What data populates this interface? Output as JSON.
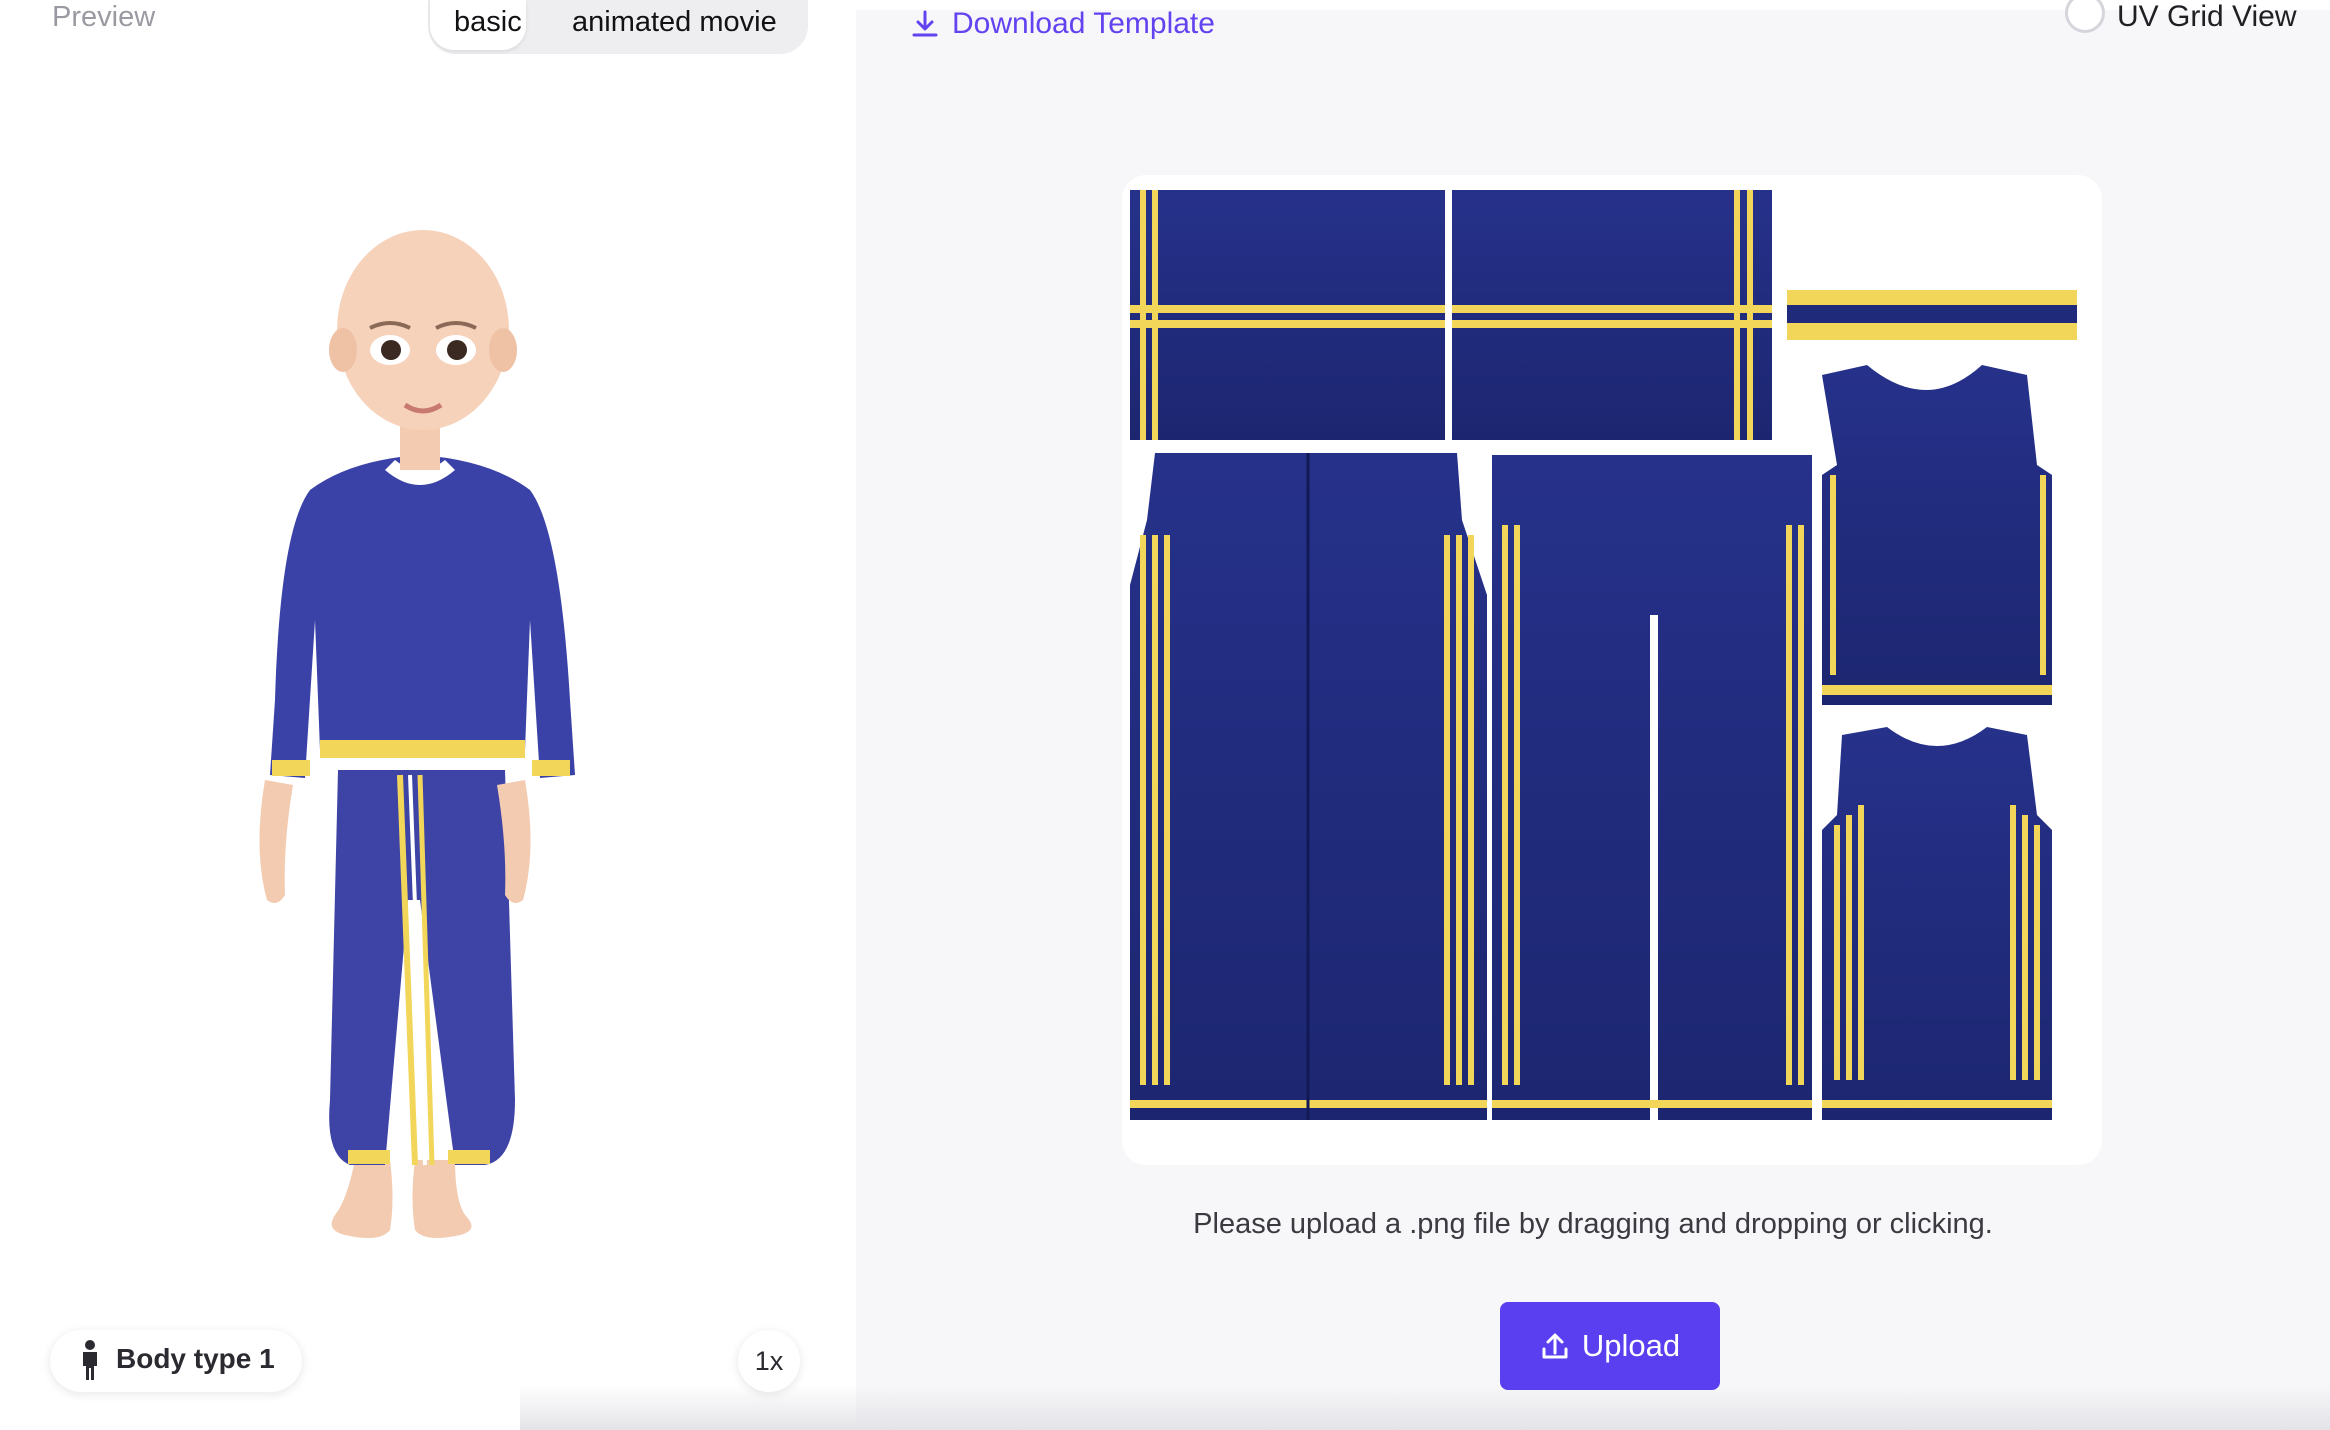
{
  "preview": {
    "label": "Preview"
  },
  "style_toggle": {
    "options": [
      "basic",
      "animated movie"
    ],
    "selected": "basic"
  },
  "body_type": {
    "label": "Body type 1",
    "icon": "person-icon"
  },
  "zoom": {
    "label": "1x"
  },
  "download": {
    "label": "Download Template",
    "icon": "download-icon"
  },
  "uv_grid": {
    "label": "UV Grid View",
    "checked": false
  },
  "upload": {
    "hint": "Please upload a .png file by dragging and dropping or clicking.",
    "button_label": "Upload",
    "icon": "upload-icon"
  },
  "colors": {
    "accent": "#5a3ff0",
    "link": "#6342f0",
    "garment_navy": "#1f2a7a",
    "garment_stripe": "#f2d65a"
  }
}
